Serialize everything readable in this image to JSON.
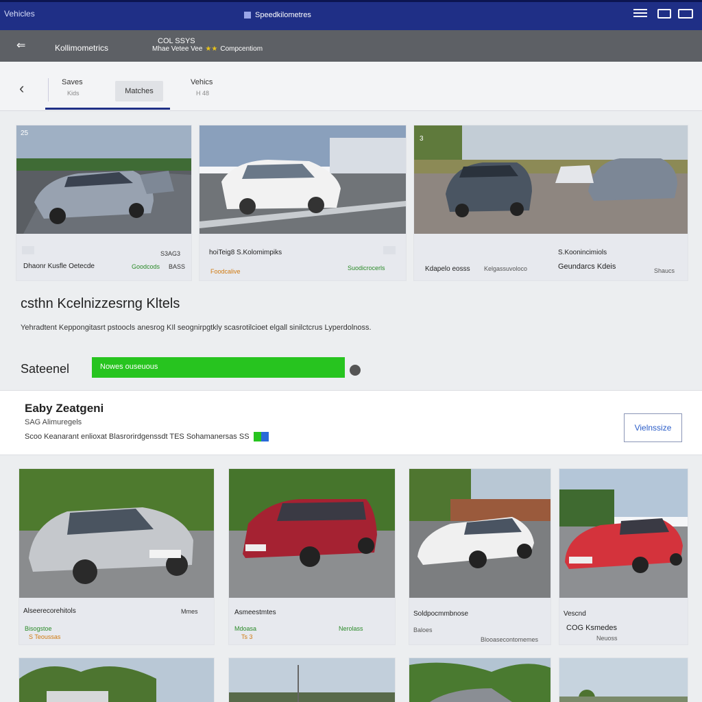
{
  "topbar": {
    "brand": "Vehicles",
    "center_title": "Speedkilometres",
    "icons": [
      "menu-icon",
      "chat-icon",
      "dashboard-icon"
    ]
  },
  "subbar": {
    "back_icon": "back-arrow-icon",
    "title": "Kollimometrics",
    "meta_top": "COL SSYS",
    "meta_bottom": "Mhae Vetee Vee",
    "meta_suffix": "Compcentiom"
  },
  "tabs": {
    "saves": {
      "label": "Saves",
      "sub": "Kids"
    },
    "matches": {
      "label": "Matches"
    },
    "vehicles": {
      "label": "Vehics",
      "sub": "H 48"
    }
  },
  "top_cards": [
    {
      "num": "25",
      "t1": "Dhaonr Kusfle Oetecde",
      "price": "S3AG3",
      "green": "Goodcods",
      "price2": "BASS"
    },
    {
      "num": "",
      "t1": "hoiTeig8 S.Kolomimpiks",
      "orange": "Foodcalive",
      "green": "Suodicrocerls"
    },
    {
      "num": "3",
      "t1": "Kdapelo eosss",
      "t2": "Kelgassuvoloco",
      "right1": "S.Koonincimiols",
      "right2": "Geundarcs Kdeis",
      "right3": "Shaucs"
    }
  ],
  "section": {
    "title": "csthn Kcelnizzesrng Kltels",
    "description": "Yehradtent Keppongitasrt pstoocls anesrog KIl seognirpgtkly scasrotilcioet elgall sinilctcrus Lyperdolnoss.",
    "search_label": "Sateenel",
    "search_value": "Nowes ouseuous"
  },
  "seller": {
    "name": "Eaby Zeatgeni",
    "count": "SAG Alimuregels",
    "details": "Scoo Keanarant enlioxat Blasrorirdgenssdt TES Sohamanersas SS",
    "button": "Vielnssize"
  },
  "bottom_cards": [
    {
      "t1": "Alseerecorehitols",
      "price": "Mmes",
      "green": "Bisogstoe",
      "orange": "S Teoussas"
    },
    {
      "t1": "Asmeestmtes",
      "green": "Mdoasa",
      "orange": "Ts 3",
      "green2": "Nerolass"
    },
    {
      "t1": "Soldpocmmbnose",
      "t2": "Baloes",
      "t3": "Blooasecontomemes"
    },
    {
      "t1": "Vescnd",
      "t2": "COG Ksmedes",
      "t3": "Neuoss"
    }
  ],
  "colors": {
    "topbar": "#1f2f86",
    "subbar": "#5d6065",
    "search_green": "#27c41f",
    "accent_blue": "#2a5cc8"
  }
}
